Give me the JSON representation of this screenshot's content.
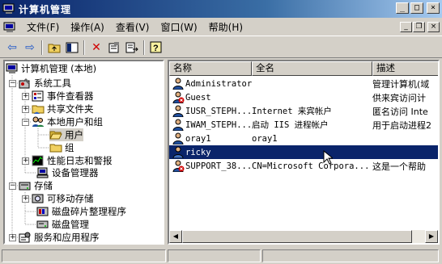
{
  "window": {
    "title": "计算机管理"
  },
  "window_controls": {
    "minimize": "_",
    "maximize": "□",
    "close": "×",
    "mdi_minimize": "_",
    "mdi_restore": "❐",
    "mdi_close": "×"
  },
  "menu": [
    {
      "label": "文件(F)"
    },
    {
      "label": "操作(A)"
    },
    {
      "label": "查看(V)"
    },
    {
      "label": "窗口(W)"
    },
    {
      "label": "帮助(H)"
    }
  ],
  "toolbar": {
    "back": "⇦",
    "forward": "⇨",
    "up": "⬆",
    "show_hide_tree": "▥",
    "delete": "✕",
    "properties": "▤",
    "export": "⇥",
    "help": "?"
  },
  "tree": [
    {
      "label": "计算机管理 (本地)",
      "icon": "computer-management-icon"
    },
    {
      "label": "系统工具",
      "icon": "system-tools-icon",
      "expander": "−"
    },
    {
      "label": "事件查看器",
      "icon": "event-viewer-icon",
      "expander": "+"
    },
    {
      "label": "共享文件夹",
      "icon": "shared-folders-icon",
      "expander": "+"
    },
    {
      "label": "本地用户和组",
      "icon": "local-users-groups-icon",
      "expander": "−"
    },
    {
      "label": "用户",
      "icon": "folder-open-icon"
    },
    {
      "label": "组",
      "icon": "folder-icon"
    },
    {
      "label": "性能日志和警报",
      "icon": "performance-logs-icon",
      "expander": "+"
    },
    {
      "label": "设备管理器",
      "icon": "device-manager-icon"
    },
    {
      "label": "存储",
      "icon": "storage-icon",
      "expander": "−"
    },
    {
      "label": "可移动存储",
      "icon": "removable-storage-icon",
      "expander": "+"
    },
    {
      "label": "磁盘碎片整理程序",
      "icon": "defragmenter-icon"
    },
    {
      "label": "磁盘管理",
      "icon": "disk-management-icon"
    },
    {
      "label": "服务和应用程序",
      "icon": "services-apps-icon",
      "expander": "+"
    }
  ],
  "list": {
    "columns": [
      "名称",
      "全名",
      "描述"
    ],
    "rows": [
      {
        "name": "Administrator",
        "full_name": "",
        "description": "管理计算机(域",
        "disabled": false
      },
      {
        "name": "Guest",
        "full_name": "",
        "description": "供来宾访问计",
        "disabled": true
      },
      {
        "name": "IUSR_STEPH...",
        "full_name": "Internet 来宾帐户",
        "description": "匿名访问 Inte",
        "disabled": false
      },
      {
        "name": "IWAM_STEPH...",
        "full_name": "启动 IIS 进程帐户",
        "description": "用于启动进程2",
        "disabled": false
      },
      {
        "name": "oray1",
        "full_name": "oray1",
        "description": "",
        "disabled": false
      },
      {
        "name": "ricky",
        "full_name": "",
        "description": "",
        "disabled": false,
        "selected": true
      },
      {
        "name": "SUPPORT_38...",
        "full_name": "CN=Microsoft Corpora...",
        "description": "这是一个帮助",
        "disabled": true
      }
    ]
  },
  "scroll": {
    "left": "◀",
    "right": "▶"
  },
  "colors": {
    "title_bar": "#0a246a",
    "selection": "#0a246a",
    "face": "#d4d0c8"
  }
}
